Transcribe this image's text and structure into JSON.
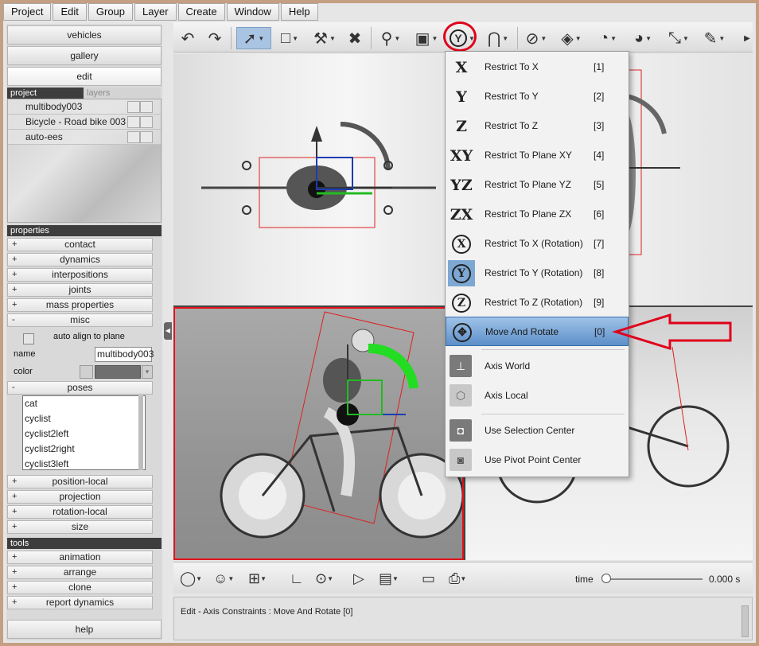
{
  "menubar": [
    "Project",
    "Edit",
    "Group",
    "Layer",
    "Create",
    "Window",
    "Help"
  ],
  "nav": {
    "vehicles": "vehicles",
    "gallery": "gallery",
    "edit": "edit"
  },
  "pane_tabs": {
    "project": "project",
    "layers": "layers"
  },
  "project_items": [
    "multibody003",
    "Bicycle - Road bike 003",
    "auto-ees"
  ],
  "properties": {
    "header": "properties",
    "rows": [
      {
        "sign": "+",
        "label": "contact"
      },
      {
        "sign": "+",
        "label": "dynamics"
      },
      {
        "sign": "+",
        "label": "interpositions"
      },
      {
        "sign": "+",
        "label": "joints"
      },
      {
        "sign": "+",
        "label": "mass properties"
      },
      {
        "sign": "-",
        "label": "misc"
      }
    ],
    "misc": {
      "auto_align_label": "auto align to plane",
      "name_label": "name",
      "name_value": "multibody003",
      "color_label": "color"
    },
    "poses_row": {
      "sign": "-",
      "label": "poses"
    },
    "poses": [
      "cat",
      "cyclist",
      "cyclist2left",
      "cyclist2right",
      "cyclist3left"
    ],
    "rows_after": [
      {
        "sign": "+",
        "label": "position-local"
      },
      {
        "sign": "+",
        "label": "projection"
      },
      {
        "sign": "+",
        "label": "rotation-local"
      },
      {
        "sign": "+",
        "label": "size"
      }
    ]
  },
  "tools": {
    "header": "tools",
    "rows": [
      {
        "sign": "+",
        "label": "animation"
      },
      {
        "sign": "+",
        "label": "arrange"
      },
      {
        "sign": "+",
        "label": "clone"
      },
      {
        "sign": "+",
        "label": "report dynamics"
      }
    ]
  },
  "help_label": "help",
  "axis_menu": {
    "items": [
      {
        "icon": "X",
        "label": "Restrict To X",
        "key": "[1]"
      },
      {
        "icon": "Y",
        "label": "Restrict To Y",
        "key": "[2]"
      },
      {
        "icon": "Z",
        "label": "Restrict To Z",
        "key": "[3]"
      },
      {
        "icon": "XY",
        "label": "Restrict To Plane XY",
        "key": "[4]"
      },
      {
        "icon": "YZ",
        "label": "Restrict To Plane YZ",
        "key": "[5]"
      },
      {
        "icon": "ZX",
        "label": "Restrict To Plane ZX",
        "key": "[6]"
      },
      {
        "icon": "X",
        "label": "Restrict To X (Rotation)",
        "key": "[7]"
      },
      {
        "icon": "Y",
        "label": "Restrict To Y (Rotation)",
        "key": "[8]"
      },
      {
        "icon": "Z",
        "label": "Restrict To Z (Rotation)",
        "key": "[9]"
      },
      {
        "icon": "move-rotate-icon",
        "label": "Move And Rotate",
        "key": "[0]"
      }
    ],
    "axis": [
      {
        "label": "Axis World"
      },
      {
        "label": "Axis Local"
      }
    ],
    "center": [
      {
        "label": "Use Selection Center"
      },
      {
        "label": "Use Pivot Point Center"
      }
    ]
  },
  "time": {
    "label": "time",
    "value": "0.000 s"
  },
  "status": "Edit - Axis Constraints : Move And Rotate [0]",
  "colors": {
    "highlight": "#e0001a",
    "selection": "#5d8fc9",
    "gizmo_green": "#22cc22"
  }
}
